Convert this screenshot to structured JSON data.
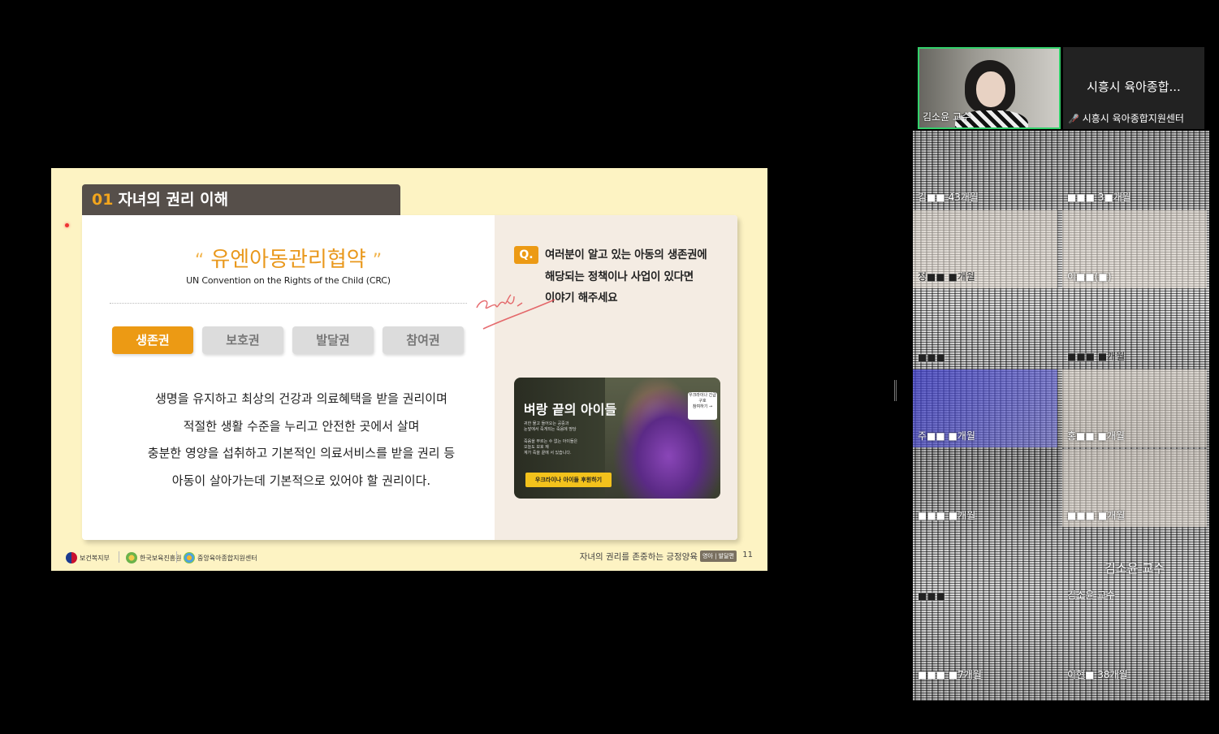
{
  "slide": {
    "section_number": "01",
    "section_title": "자녀의 권리 이해",
    "convention_title": "유엔아동관리협약",
    "quote_open": "“",
    "quote_close": "”",
    "convention_subtitle": "UN Convention on the Rights of the Child (CRC)",
    "tabs": [
      {
        "label": "생존권",
        "active": true
      },
      {
        "label": "보호권",
        "active": false
      },
      {
        "label": "발달권",
        "active": false
      },
      {
        "label": "참여권",
        "active": false
      }
    ],
    "description": [
      "생명을 유지하고 최상의 건강과 의료혜택을 받을 권리이며",
      "적절한 생활 수준을 누리고 안전한 곳에서 살며",
      "충분한 영양을 섭취하고 기본적인 의료서비스를 받을 권리 등",
      "아동이 살아가는데 기본적으로 있어야 할 권리이다."
    ],
    "question_badge": "Q.",
    "question_lines": [
      "여러분이 알고 있는 아동의 생존권에",
      "해당되는 정책이나 사업이 있다면",
      "이야기 해주세요"
    ],
    "ad": {
      "title": "벼랑 끝의 아이들",
      "body_lines": [
        "귀한 물고 들어오는 공중과",
        "눈앞에서 죽게되는 죽음에 땅당",
        "",
        "죽음을 부르는 수 없는 아이들은",
        "오늘도 보호 재",
        "계가 죽을 끝에 서 있습니다."
      ],
      "button": "우크라이나 아이들 후원하기",
      "thumb_caption": "우크라이나 긴급구호",
      "thumb_button": "참여하기 →"
    },
    "footer": {
      "logo_1": "보건복지부",
      "logo_2": "한국보육진흥원",
      "logo_3": "중앙육아종합지원센터",
      "course_title": "자녀의 권리를 존중하는 긍정양육",
      "badge": "영아 | 발달편",
      "page": "11"
    },
    "colors": {
      "accent": "#ec9a14",
      "header_bg": "#564f4a",
      "slide_bg": "#fdf3c3"
    }
  },
  "participants": {
    "active_speaker": {
      "name": "김소윤 교수"
    },
    "second_tile": {
      "title": "시흥시 육아종합...",
      "name": "시흥시 육아종합지원센터"
    },
    "grid": [
      {
        "name": "김■■ 43개월"
      },
      {
        "name": "■■■ 3■개월"
      },
      {
        "name": "정■■ ■개월"
      },
      {
        "name": "이■■(■)"
      },
      {
        "name": "■■■"
      },
      {
        "name": "■■■ ■개월"
      },
      {
        "name": "주■■ ■개월"
      },
      {
        "name": "홍■■ ■개월"
      },
      {
        "name": "■■■ ■개월"
      },
      {
        "name": "■■■ ■개월"
      },
      {
        "name": "■■■"
      },
      {
        "name": "김소윤 교수",
        "big": "김소윤 교수"
      },
      {
        "name": "■■■ ■7개월"
      },
      {
        "name": "이현■ 38개월"
      }
    ],
    "colors": {
      "active_border": "#33d06b",
      "mic_off": "#e5413a"
    }
  }
}
